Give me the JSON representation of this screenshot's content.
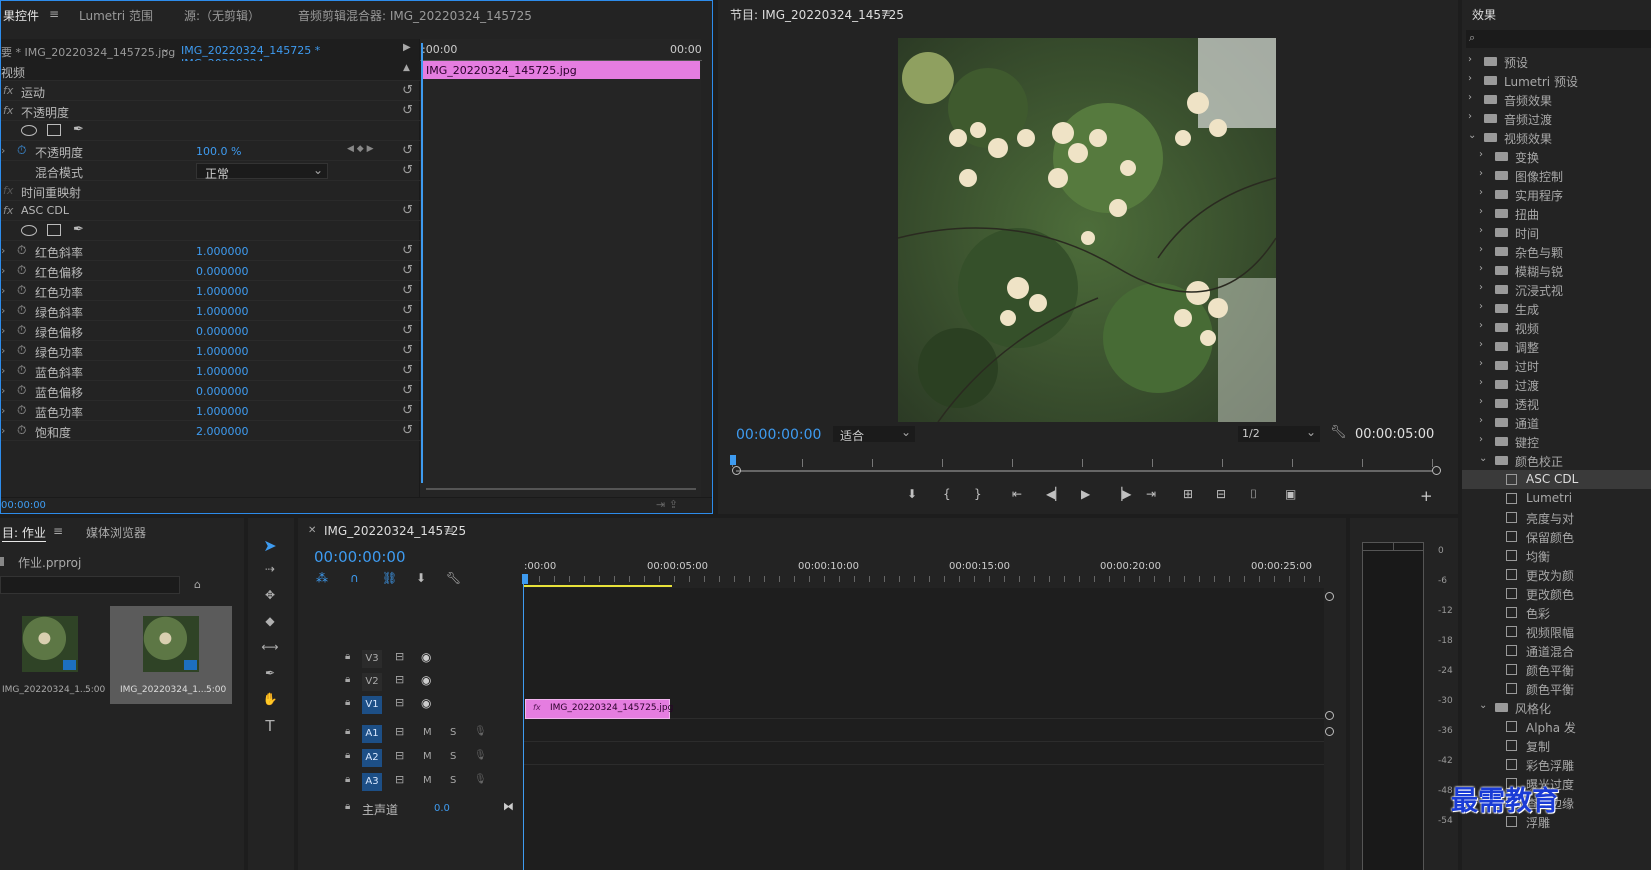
{
  "effect_controls": {
    "tabs": [
      "果控件",
      "Lumetri 范围",
      "源:（无剪辑）",
      "音频剪辑混合器: IMG_20220324_145725"
    ],
    "master_clip": "要 * IMG_20220324_145725.jpg",
    "sequence_clip": "IMG_20220324_145725 * IMG_20220324_...",
    "time_start": ":00:00",
    "time_end": "00:00",
    "clip_bar_label": "IMG_20220324_145725.jpg",
    "section": "视频",
    "motion": "运动",
    "opacity_group": "不透明度",
    "opacity_label": "不透明度",
    "opacity_value": "100.0 %",
    "blend_label": "混合模式",
    "blend_value": "正常",
    "time_remap": "时间重映射",
    "asc_cdl": "ASC CDL",
    "params": [
      {
        "label": "红色斜率",
        "value": "1.000000"
      },
      {
        "label": "红色偏移",
        "value": "0.000000"
      },
      {
        "label": "红色功率",
        "value": "1.000000"
      },
      {
        "label": "绿色斜率",
        "value": "1.000000"
      },
      {
        "label": "绿色偏移",
        "value": "0.000000"
      },
      {
        "label": "绿色功率",
        "value": "1.000000"
      },
      {
        "label": "蓝色斜率",
        "value": "1.000000"
      },
      {
        "label": "蓝色偏移",
        "value": "0.000000"
      },
      {
        "label": "蓝色功率",
        "value": "1.000000"
      },
      {
        "label": "饱和度",
        "value": "2.000000"
      }
    ],
    "footer_time": "00:00:00"
  },
  "program": {
    "title": "节目: IMG_20220324_145725",
    "timecode": "00:00:00:00",
    "fit": "适合",
    "quality": "1/2",
    "duration": "00:00:05:00"
  },
  "effects_panel": {
    "title": "效果",
    "items": [
      {
        "label": "预设",
        "indent": 0,
        "type": "folder",
        "expanded": false
      },
      {
        "label": "Lumetri 预设",
        "indent": 0,
        "type": "folder",
        "expanded": false
      },
      {
        "label": "音频效果",
        "indent": 0,
        "type": "folder",
        "expanded": false
      },
      {
        "label": "音频过渡",
        "indent": 0,
        "type": "folder",
        "expanded": false
      },
      {
        "label": "视频效果",
        "indent": 0,
        "type": "folder",
        "expanded": true
      },
      {
        "label": "变换",
        "indent": 1,
        "type": "folder",
        "expanded": false
      },
      {
        "label": "图像控制",
        "indent": 1,
        "type": "folder",
        "expanded": false
      },
      {
        "label": "实用程序",
        "indent": 1,
        "type": "folder",
        "expanded": false
      },
      {
        "label": "扭曲",
        "indent": 1,
        "type": "folder",
        "expanded": false
      },
      {
        "label": "时间",
        "indent": 1,
        "type": "folder",
        "expanded": false
      },
      {
        "label": "杂色与颗",
        "indent": 1,
        "type": "folder",
        "expanded": false
      },
      {
        "label": "模糊与锐",
        "indent": 1,
        "type": "folder",
        "expanded": false
      },
      {
        "label": "沉浸式视",
        "indent": 1,
        "type": "folder",
        "expanded": false
      },
      {
        "label": "生成",
        "indent": 1,
        "type": "folder",
        "expanded": false
      },
      {
        "label": "视频",
        "indent": 1,
        "type": "folder",
        "expanded": false
      },
      {
        "label": "调整",
        "indent": 1,
        "type": "folder",
        "expanded": false
      },
      {
        "label": "过时",
        "indent": 1,
        "type": "folder",
        "expanded": false
      },
      {
        "label": "过渡",
        "indent": 1,
        "type": "folder",
        "expanded": false
      },
      {
        "label": "透视",
        "indent": 1,
        "type": "folder",
        "expanded": false
      },
      {
        "label": "通道",
        "indent": 1,
        "type": "folder",
        "expanded": false
      },
      {
        "label": "键控",
        "indent": 1,
        "type": "folder",
        "expanded": false
      },
      {
        "label": "颜色校正",
        "indent": 1,
        "type": "folder",
        "expanded": true
      },
      {
        "label": "ASC CDL",
        "indent": 2,
        "type": "fx",
        "selected": true
      },
      {
        "label": "Lumetri",
        "indent": 2,
        "type": "fx"
      },
      {
        "label": "亮度与对",
        "indent": 2,
        "type": "fx"
      },
      {
        "label": "保留颜色",
        "indent": 2,
        "type": "fx"
      },
      {
        "label": "均衡",
        "indent": 2,
        "type": "fx"
      },
      {
        "label": "更改为颜",
        "indent": 2,
        "type": "fx"
      },
      {
        "label": "更改颜色",
        "indent": 2,
        "type": "fx"
      },
      {
        "label": "色彩",
        "indent": 2,
        "type": "fx"
      },
      {
        "label": "视频限幅",
        "indent": 2,
        "type": "fx"
      },
      {
        "label": "通道混合",
        "indent": 2,
        "type": "fx"
      },
      {
        "label": "颜色平衡",
        "indent": 2,
        "type": "fx"
      },
      {
        "label": "颜色平衡",
        "indent": 2,
        "type": "fx"
      },
      {
        "label": "风格化",
        "indent": 1,
        "type": "folder",
        "expanded": true
      },
      {
        "label": "Alpha 发",
        "indent": 2,
        "type": "fx"
      },
      {
        "label": "复制",
        "indent": 2,
        "type": "fx"
      },
      {
        "label": "彩色浮雕",
        "indent": 2,
        "type": "fx"
      },
      {
        "label": "曝光过度",
        "indent": 2,
        "type": "fx"
      },
      {
        "label": "查找边缘",
        "indent": 2,
        "type": "fx"
      },
      {
        "label": "浮雕",
        "indent": 2,
        "type": "fx"
      }
    ]
  },
  "project": {
    "tabs": [
      "目: 作业",
      "媒体浏览器"
    ],
    "file": "作业.prproj",
    "items": [
      {
        "name": "IMG_20220324_1...",
        "duration": "5:00"
      },
      {
        "name": "IMG_20220324_1...",
        "duration": "5:00"
      }
    ]
  },
  "timeline": {
    "tab": "IMG_20220324_145725",
    "timecode": "00:00:00:00",
    "ruler": [
      ":00:00",
      "00:00:05:00",
      "00:00:10:00",
      "00:00:15:00",
      "00:00:20:00",
      "00:00:25:00"
    ],
    "video_tracks": [
      "V3",
      "V2",
      "V1"
    ],
    "audio_tracks": [
      "A1",
      "A2",
      "A3"
    ],
    "master_label": "主声道",
    "master_value": "0.0",
    "clip_label": "IMG_20220324_145725.jpg",
    "m": "M",
    "s": "S",
    "fx": "fx"
  },
  "meter": {
    "scale": [
      "0",
      "-6",
      "-12",
      "-18",
      "-24",
      "-30",
      "-36",
      "-42",
      "-48",
      "-54"
    ]
  },
  "watermark": "最需教育"
}
